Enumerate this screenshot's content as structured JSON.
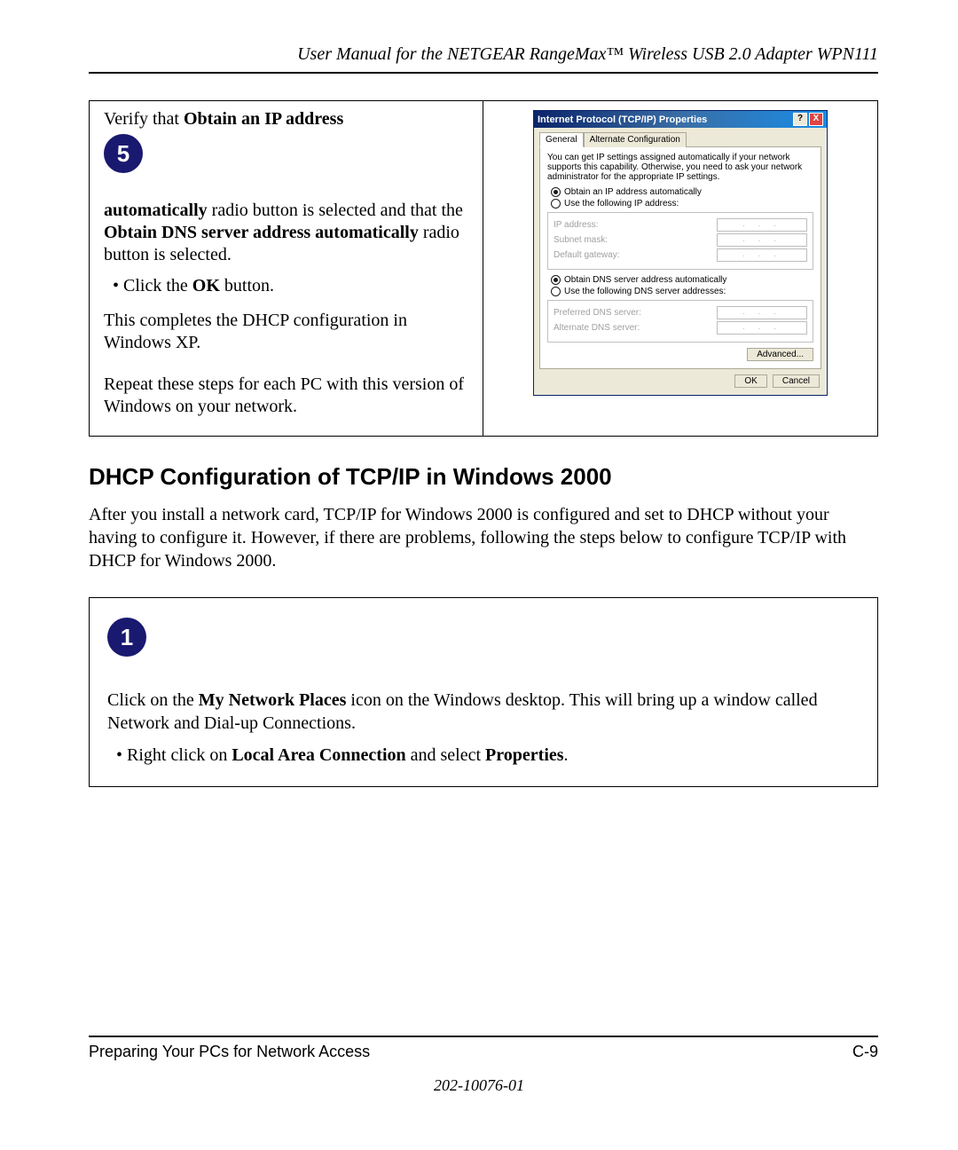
{
  "header": "User Manual for the NETGEAR RangeMax™ Wireless USB 2.0 Adapter WPN111",
  "step5": {
    "badge": "5",
    "line1_a": "Verify that ",
    "line1_b": "Obtain an IP address ",
    "line2_a": "automatically",
    "line2_b": " radio button is selected and that the ",
    "line2_c": "Obtain DNS server address automatically",
    "line2_d": " radio button is selected.",
    "bullet_a": "Click the ",
    "bullet_b": "OK",
    "bullet_c": " button.",
    "para2": "This completes the DHCP configuration in Windows XP.",
    "para3": "Repeat these steps for each PC with this version of Windows on your network."
  },
  "dialog": {
    "title": "Internet Protocol (TCP/IP) Properties",
    "help": "?",
    "close": "X",
    "tab_general": "General",
    "tab_alt": "Alternate Configuration",
    "desc": "You can get IP settings assigned automatically if your network supports this capability. Otherwise, you need to ask your network administrator for the appropriate IP settings.",
    "r1": "Obtain an IP address automatically",
    "r2": "Use the following IP address:",
    "ip_label": "IP address:",
    "subnet_label": "Subnet mask:",
    "gateway_label": "Default gateway:",
    "r3": "Obtain DNS server address automatically",
    "r4": "Use the following DNS server addresses:",
    "pdns_label": "Preferred DNS server:",
    "adns_label": "Alternate DNS server:",
    "dots": ". . .",
    "advanced": "Advanced...",
    "ok": "OK",
    "cancel": "Cancel"
  },
  "section_heading": "DHCP Configuration of TCP/IP in Windows 2000",
  "section_body": "After you install a network card, TCP/IP for Windows 2000 is configured and set to DHCP without your having to configure it.  However, if there are problems, following the steps below to configure TCP/IP with DHCP for Windows 2000.",
  "step1": {
    "badge": "1",
    "p1_a": "Click on the ",
    "p1_b": "My Network Places",
    "p1_c": " icon on the Windows desktop.  This will bring up a window called Network and Dial-up Connections.",
    "bullet_a": "Right click on ",
    "bullet_b": "Local Area Connection",
    "bullet_c": " and select ",
    "bullet_d": "Properties",
    "bullet_e": "."
  },
  "footer": {
    "left": "Preparing Your PCs for Network Access",
    "right": "C-9",
    "docnum": "202-10076-01"
  }
}
